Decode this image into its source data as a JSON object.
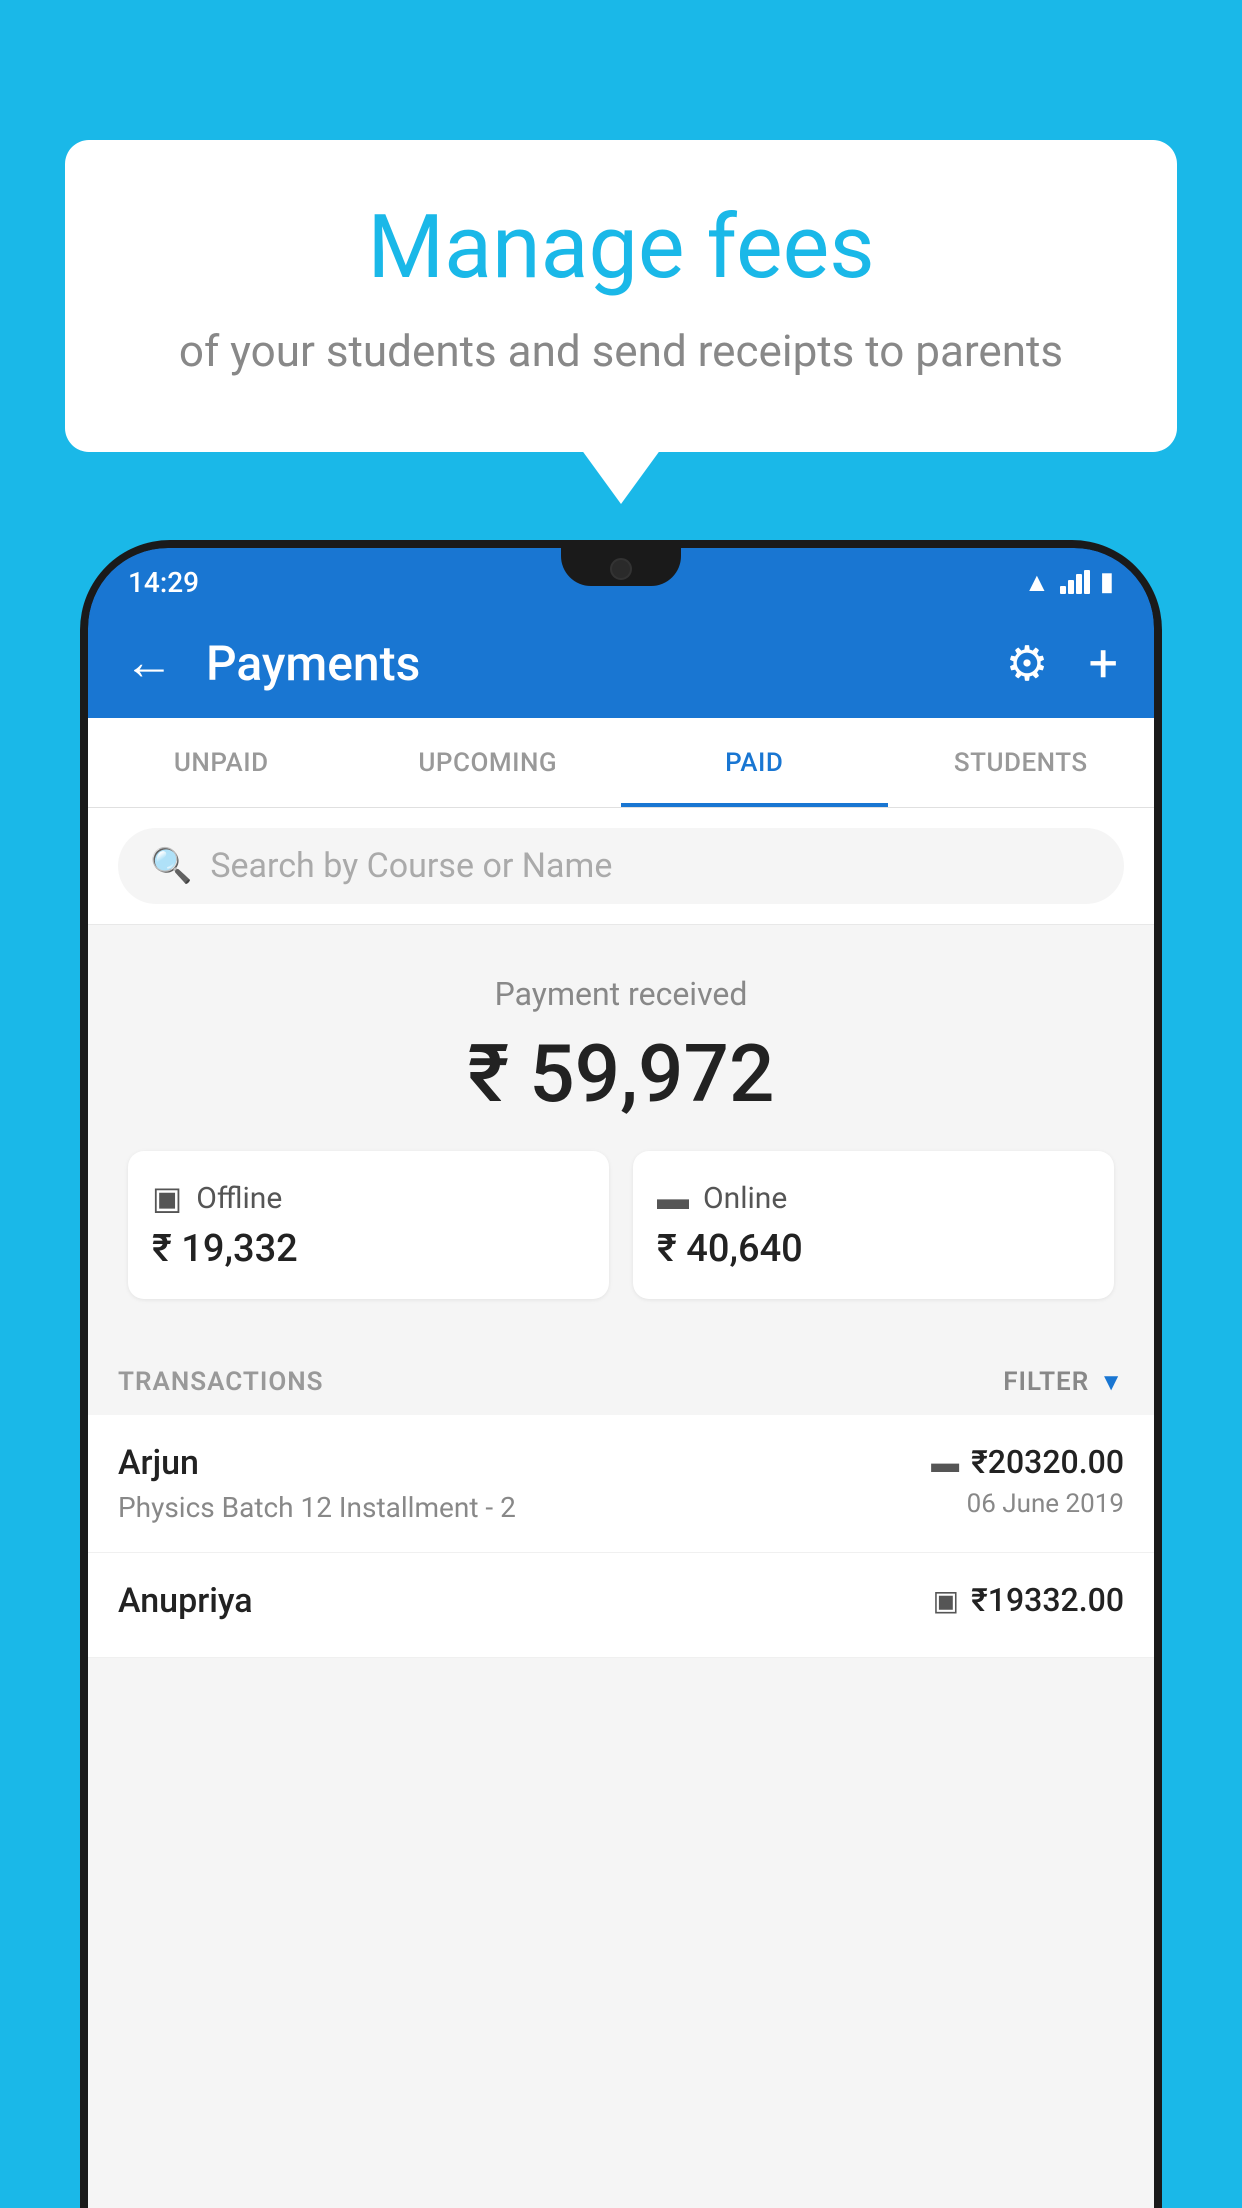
{
  "background_color": "#1ab8e8",
  "speech_bubble": {
    "title": "Manage fees",
    "subtitle": "of your students and send receipts to parents"
  },
  "status_bar": {
    "time": "14:29",
    "wifi_icon": "▲",
    "signal_icon": "▲",
    "battery_icon": "▮"
  },
  "app_bar": {
    "back_label": "←",
    "title": "Payments",
    "gear_label": "⚙",
    "plus_label": "+"
  },
  "tabs": [
    {
      "id": "unpaid",
      "label": "UNPAID",
      "active": false
    },
    {
      "id": "upcoming",
      "label": "UPCOMING",
      "active": false
    },
    {
      "id": "paid",
      "label": "PAID",
      "active": true
    },
    {
      "id": "students",
      "label": "STUDENTS",
      "active": false
    }
  ],
  "search": {
    "placeholder": "Search by Course or Name"
  },
  "payment_summary": {
    "label": "Payment received",
    "amount": "₹ 59,972",
    "offline_label": "Offline",
    "offline_amount": "₹ 19,332",
    "online_label": "Online",
    "online_amount": "₹ 40,640"
  },
  "transactions_header": {
    "label": "TRANSACTIONS",
    "filter_label": "FILTER"
  },
  "transactions": [
    {
      "name": "Arjun",
      "course": "Physics Batch 12 Installment - 2",
      "payment_type": "online",
      "amount": "₹20320.00",
      "date": "06 June 2019"
    },
    {
      "name": "Anupriya",
      "course": "",
      "payment_type": "offline",
      "amount": "₹19332.00",
      "date": ""
    }
  ]
}
